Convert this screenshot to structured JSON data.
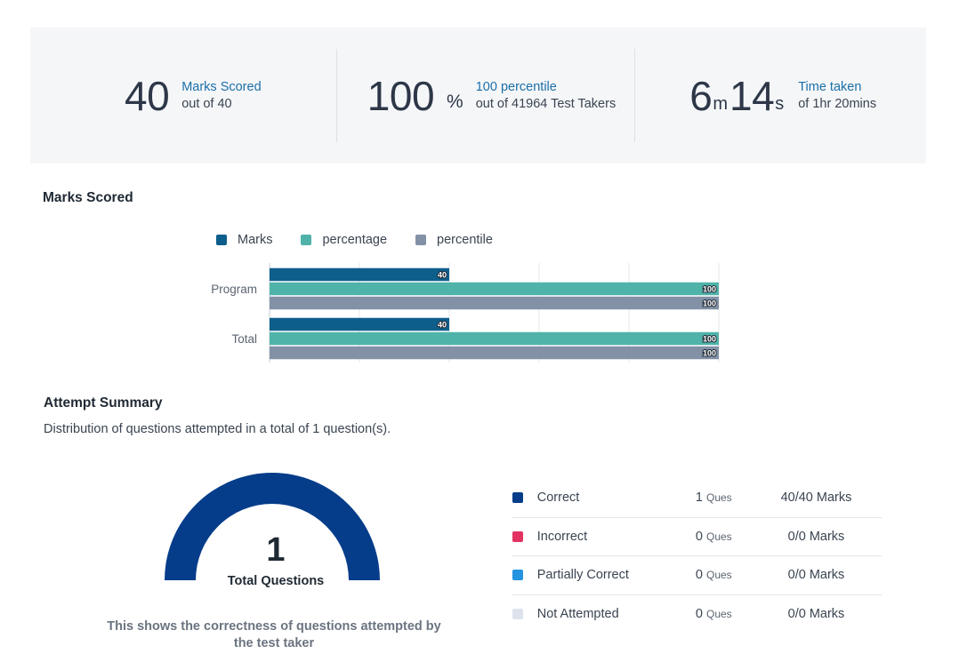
{
  "summary": {
    "marks": {
      "value": "40",
      "title": "Marks Scored",
      "sub": "out of 40"
    },
    "percent": {
      "value": "100",
      "unit": "%",
      "title": "100 percentile",
      "sub": "out of 41964 Test Takers"
    },
    "time": {
      "minutes": "6",
      "minutes_unit": "m",
      "seconds": "14",
      "seconds_unit": "s",
      "title": "Time taken",
      "sub": "of 1hr 20mins"
    }
  },
  "marks_section": {
    "heading": "Marks Scored"
  },
  "chart_data": {
    "type": "bar",
    "orientation": "horizontal",
    "categories": [
      "Program",
      "Total"
    ],
    "series": [
      {
        "name": "Marks",
        "values": [
          40,
          40
        ],
        "color": "#0e5e8c"
      },
      {
        "name": "percentage",
        "values": [
          100,
          100
        ],
        "color": "#4fb3a9"
      },
      {
        "name": "percentile",
        "values": [
          100,
          100
        ],
        "color": "#8291a6"
      }
    ],
    "xlim": [
      0,
      100
    ],
    "grid": true,
    "legend": "top"
  },
  "attempt": {
    "heading": "Attempt Summary",
    "description": "Distribution of questions attempted in a total of 1 question(s).",
    "gauge": {
      "total": "1",
      "label": "Total Questions",
      "note": "This shows the correctness of questions attempted by the test taker",
      "fill_fraction": 1.0,
      "color": "#063d8a"
    },
    "rows": [
      {
        "name": "Correct",
        "count": "1",
        "unit": "Ques",
        "marks": "40/40 Marks",
        "color": "#063d8a"
      },
      {
        "name": "Incorrect",
        "count": "0",
        "unit": "Ques",
        "marks": "0/0 Marks",
        "color": "#e33362"
      },
      {
        "name": "Partially Correct",
        "count": "0",
        "unit": "Ques",
        "marks": "0/0 Marks",
        "color": "#2493e0"
      },
      {
        "name": "Not Attempted",
        "count": "0",
        "unit": "Ques",
        "marks": "0/0 Marks",
        "color": "#dde3ec"
      }
    ]
  }
}
